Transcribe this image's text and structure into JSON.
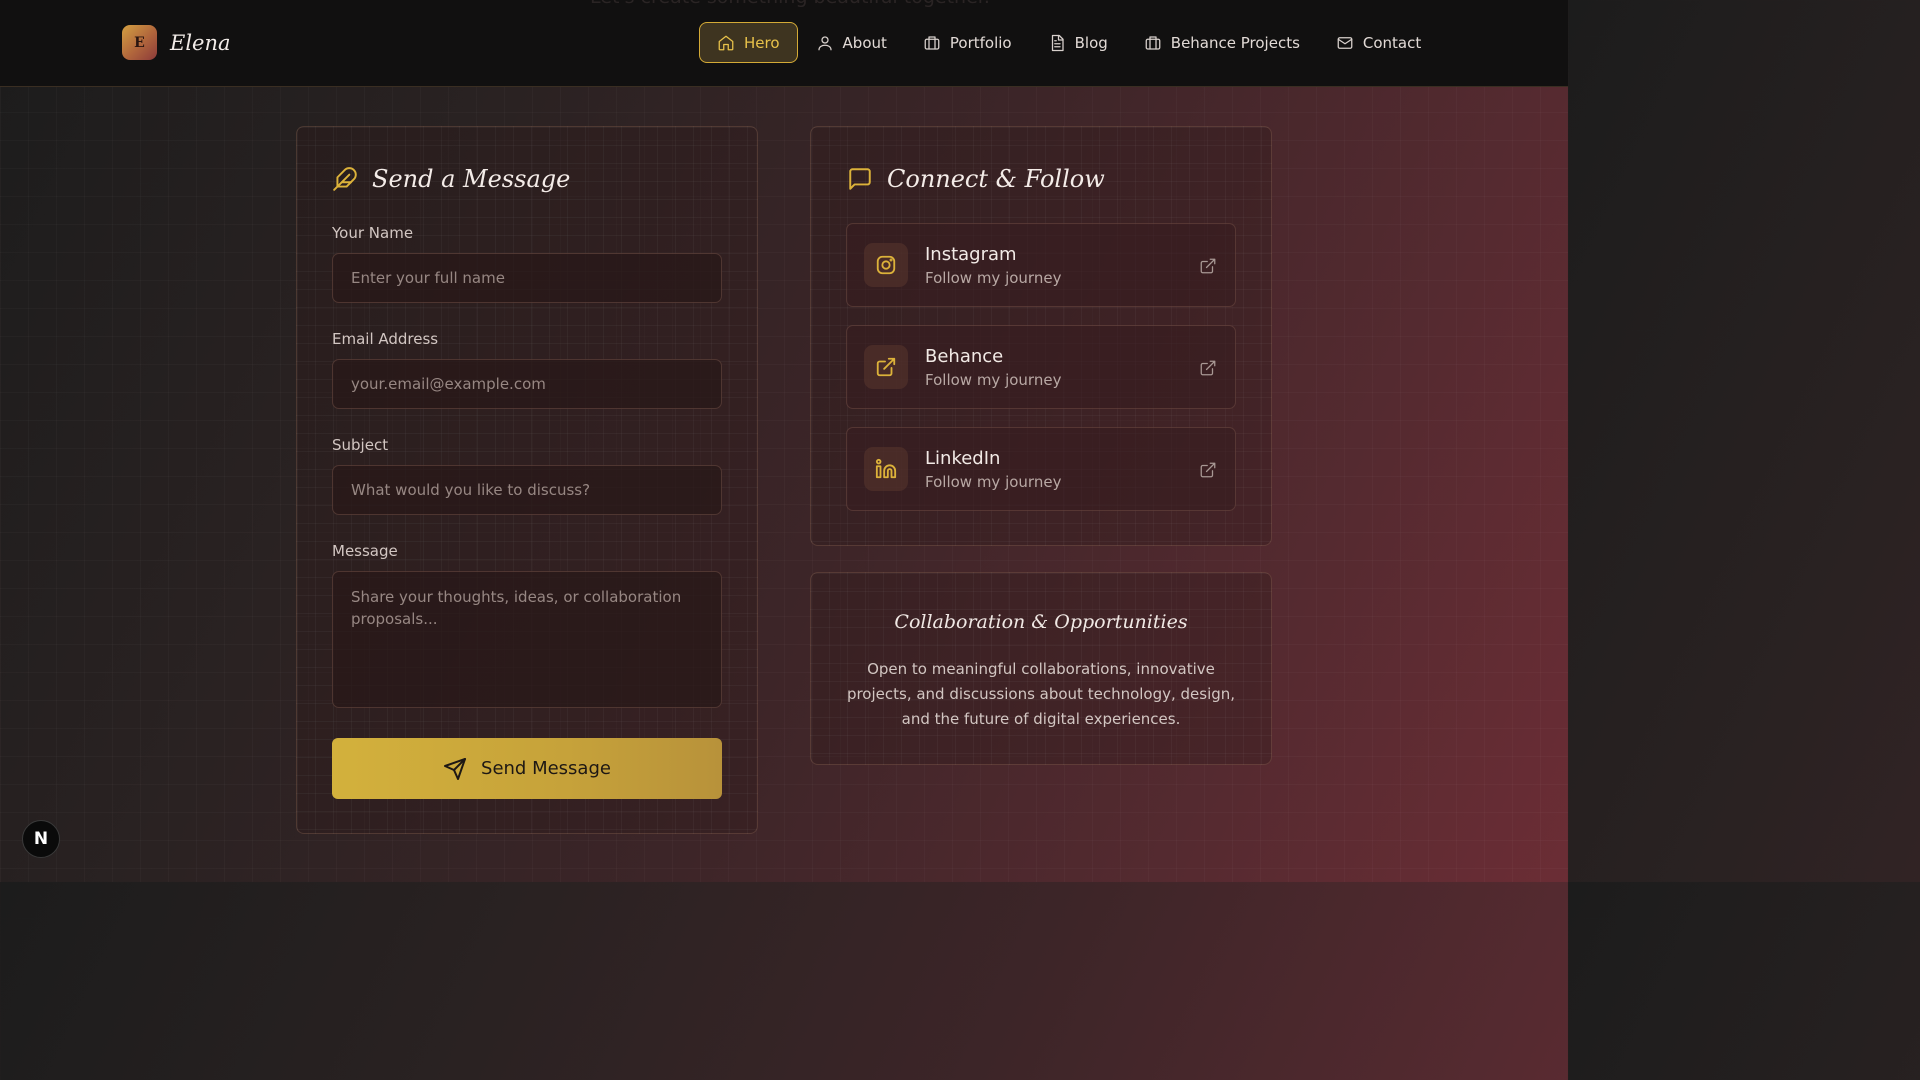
{
  "header": {
    "ghost_text": "Let's create something beautiful together.",
    "brand": {
      "initial": "E",
      "name": "Elena"
    },
    "nav": [
      {
        "label": "Hero",
        "icon": "home-icon",
        "active": true
      },
      {
        "label": "About",
        "icon": "user-icon",
        "active": false
      },
      {
        "label": "Portfolio",
        "icon": "briefcase-icon",
        "active": false
      },
      {
        "label": "Blog",
        "icon": "document-icon",
        "active": false
      },
      {
        "label": "Behance Projects",
        "icon": "briefcase-icon",
        "active": false
      },
      {
        "label": "Contact",
        "icon": "mail-icon",
        "active": false
      }
    ]
  },
  "message_form": {
    "title": "Send a Message",
    "name_label": "Your Name",
    "name_placeholder": "Enter your full name",
    "email_label": "Email Address",
    "email_placeholder": "your.email@example.com",
    "subject_label": "Subject",
    "subject_placeholder": "What would you like to discuss?",
    "message_label": "Message",
    "message_placeholder": "Share your thoughts, ideas, or collaboration proposals...",
    "submit_label": "Send Message"
  },
  "connect": {
    "title": "Connect & Follow",
    "items": [
      {
        "name": "Instagram",
        "subtitle": "Follow my journey",
        "icon": "instagram-icon"
      },
      {
        "name": "Behance",
        "subtitle": "Follow my journey",
        "icon": "external-link-icon"
      },
      {
        "name": "LinkedIn",
        "subtitle": "Follow my journey",
        "icon": "linkedin-icon"
      }
    ]
  },
  "collab": {
    "title": "Collaboration & Opportunities",
    "text": "Open to meaningful collaborations, innovative projects, and discussions about technology, design, and the future of digital experiences."
  },
  "floating_badge": "N",
  "colors": {
    "accent": "#d4aa36",
    "header_bg": "#111010"
  }
}
